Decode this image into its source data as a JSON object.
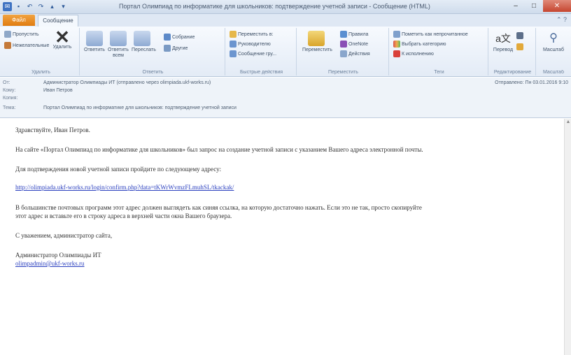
{
  "window": {
    "title": "Портал Олимпиад по информатике для школьников: подтверждение учетной записи - Сообщение (HTML)",
    "tabs": {
      "file": "Файл",
      "message": "Сообщение"
    }
  },
  "ribbon": {
    "groups": {
      "respond": "Удалить",
      "respond_group": "Ответить",
      "quick": "Быстрые действия",
      "move": "Переместить",
      "tags": "Теги",
      "edit": "Редактирование",
      "zoom": "Масштаб"
    },
    "buttons": {
      "ignore": "Пропустить",
      "junk": "Нежелательные",
      "delete": "Удалить",
      "reply": "Ответить",
      "reply_all": "Ответить всем",
      "forward": "Переслать",
      "meeting": "Собрание",
      "more": "Другие",
      "move_to": "Переместить в:",
      "to_manager": "Руководителю",
      "team_email": "Сообщение гру...",
      "move": "Переместить",
      "rules": "Правила",
      "onenote": "OneNote",
      "actions": "Действия",
      "mark_unread": "Пометить как непрочитанное",
      "categorize": "Выбрать категорию",
      "follow_up": "К исполнению",
      "translate": "Перевод",
      "zoom": "Масштаб"
    }
  },
  "header": {
    "from_label": "От:",
    "from_value": "Администратор Олимпиады ИТ (отправлено через olimpiada.ukf-works.ru)",
    "to_label": "Кому:",
    "to_value": "Иван Петров",
    "cc_label": "Копия:",
    "subject_label": "Тема:",
    "subject_value": "Портал Олимпиад по информатике для школьников: подтверждение учетной записи",
    "sent": "Отправлено:  Пн 03.01.2016 9:10"
  },
  "body": {
    "greeting": "Здравствуйте, Иван Петров.",
    "line1": "На сайте «Портал Олимпиад по информатике для школьников» был запрос на создание учетной записи с указанием Вашего адреса электронной почты.",
    "line2": "Для подтверждения новой учетной записи пройдите по следующему адресу:",
    "link": "http://olimpiada.ukf-works.ru/login/confirm.php?data=tKWrWvmzFLmuhSL/tkackak/",
    "line3a": "В большинстве почтовых программ этот адрес должен выглядеть как синяя ссылка, на которую достаточно нажать. Если это не так, просто скопируйте",
    "line3b": "этот адрес и вставьте его в строку адреса в верхней части окна Вашего браузера.",
    "regards": "С уважением, администратор сайта,",
    "sign_name": "Администратор Олимпиады ИТ",
    "sign_email": "olimpadmin@ukf-works.ru"
  }
}
